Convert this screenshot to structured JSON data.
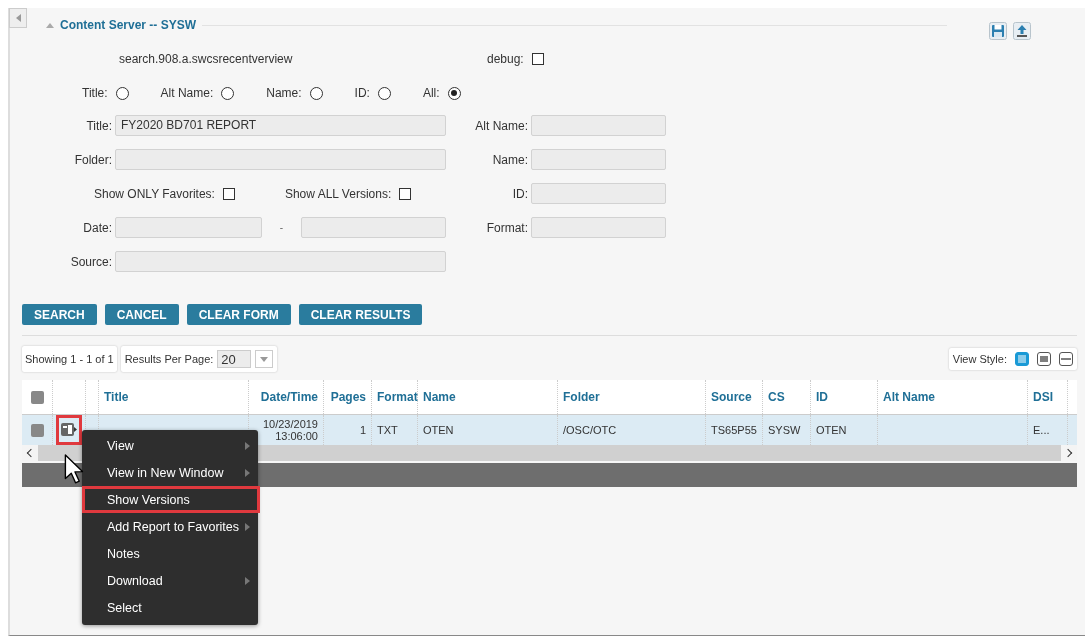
{
  "panel": {
    "title": "Content Server -- SYSW",
    "expanded": true
  },
  "search_name": "search.908.a.swcsrecentverview",
  "debug": {
    "label": "debug:",
    "checked": false
  },
  "search_by": [
    {
      "label": "Title:",
      "selected": false
    },
    {
      "label": "Alt Name:",
      "selected": false
    },
    {
      "label": "Name:",
      "selected": false
    },
    {
      "label": "ID:",
      "selected": false
    },
    {
      "label": "All:",
      "selected": true
    }
  ],
  "form": {
    "title": {
      "label": "Title:",
      "value": "FY2020 BD701 REPORT"
    },
    "alt_name": {
      "label": "Alt Name:"
    },
    "folder": {
      "label": "Folder:"
    },
    "name": {
      "label": "Name:"
    },
    "favorites": {
      "label": "Show ONLY Favorites:",
      "checked": false
    },
    "all_versions": {
      "label": "Show ALL Versions:",
      "checked": false
    },
    "id": {
      "label": "ID:"
    },
    "date": {
      "label": "Date:",
      "separator": "-"
    },
    "format": {
      "label": "Format:"
    },
    "source": {
      "label": "Source:"
    }
  },
  "buttons": [
    "SEARCH",
    "CANCEL",
    "CLEAR FORM",
    "CLEAR RESULTS"
  ],
  "showing": "Showing 1 - 1 of 1",
  "results_per_page": {
    "label": "Results Per Page:",
    "value": "20"
  },
  "view_style": {
    "label": "View Style:",
    "options": [
      {
        "selected": true
      },
      {
        "selected": false
      },
      {
        "selected": false
      }
    ]
  },
  "table": {
    "header_checked": false,
    "columns": [
      "Title",
      "Date/Time",
      "Pages",
      "Format",
      "Name",
      "Folder",
      "Source",
      "CS",
      "ID",
      "Alt Name",
      "DSI"
    ],
    "rows": [
      {
        "checked": false,
        "icon_highlighted": true,
        "cells": [
          null,
          "10/23/2019 13:06:00",
          "1",
          "TXT",
          "OTEN",
          "/OSC/OTC",
          "TS65P55",
          "SYSW",
          "OTEN",
          null,
          "E..."
        ]
      }
    ]
  },
  "context_menu": [
    {
      "label": "View",
      "submenu": true,
      "highlighted": false
    },
    {
      "label": "View in New Window",
      "submenu": true,
      "highlighted": false
    },
    {
      "label": "Show Versions",
      "submenu": false,
      "highlighted": true
    },
    {
      "label": "Add Report to Favorites",
      "submenu": true,
      "highlighted": false
    },
    {
      "label": "Notes",
      "submenu": false,
      "highlighted": false
    },
    {
      "label": "Download",
      "submenu": true,
      "highlighted": false
    },
    {
      "label": "Select",
      "submenu": false,
      "highlighted": false
    }
  ]
}
